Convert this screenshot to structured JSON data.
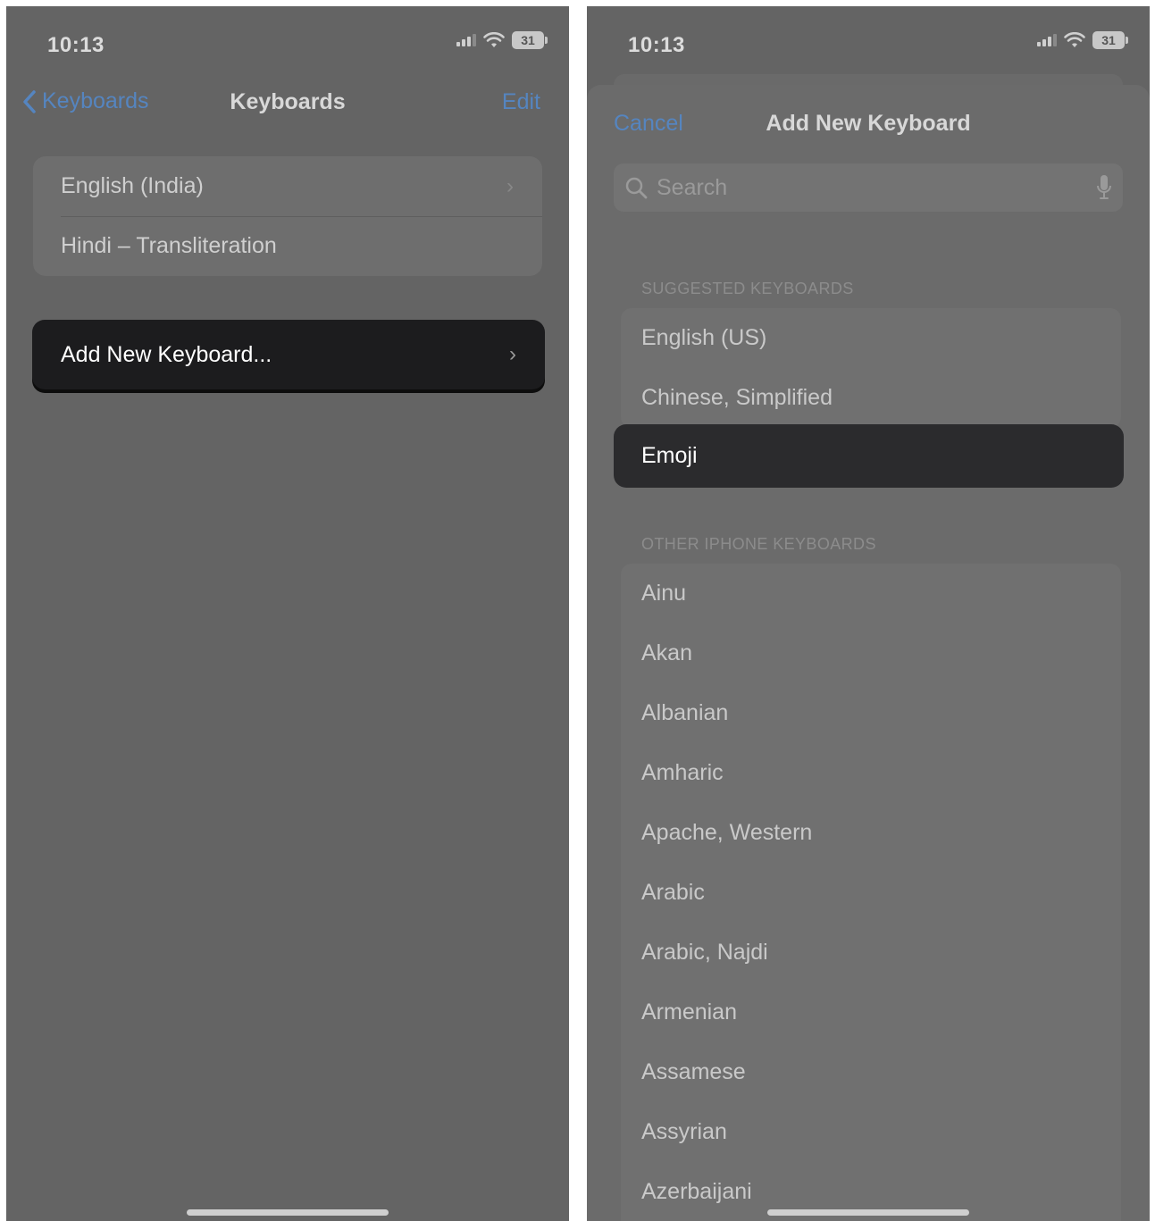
{
  "left": {
    "status": {
      "time": "10:13",
      "battery": "31"
    },
    "nav": {
      "back_label": "Keyboards",
      "title": "Keyboards",
      "edit_label": "Edit"
    },
    "keyboards": [
      "English (India)",
      "Hindi – Transliteration"
    ],
    "add_new_label": "Add New Keyboard..."
  },
  "right": {
    "status": {
      "time": "10:13",
      "battery": "31"
    },
    "sheet": {
      "cancel_label": "Cancel",
      "title": "Add New Keyboard"
    },
    "search": {
      "placeholder": "Search"
    },
    "suggested_header": "SUGGESTED KEYBOARDS",
    "suggested": [
      "English (US)",
      "Chinese, Simplified"
    ],
    "highlighted": "Emoji",
    "other_header": "OTHER IPHONE KEYBOARDS",
    "other": [
      "Ainu",
      "Akan",
      "Albanian",
      "Amharic",
      "Apache, Western",
      "Arabic",
      "Arabic, Najdi",
      "Armenian",
      "Assamese",
      "Assyrian",
      "Azerbaijani"
    ]
  },
  "colors": {
    "background": "#646464",
    "link_blue": "#5585c0",
    "highlight_cell": "#1c1c1e"
  },
  "icons": [
    "chevron-left-icon",
    "chevron-right-icon",
    "signal-icon",
    "wifi-icon",
    "battery-icon",
    "search-icon",
    "microphone-icon"
  ]
}
